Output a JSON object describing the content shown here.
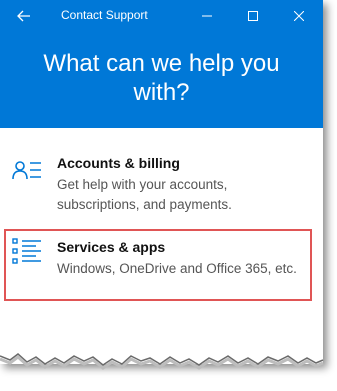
{
  "window": {
    "title": "Contact Support",
    "back_icon": "arrow-left-icon",
    "min_icon": "minimize-icon",
    "max_icon": "maximize-icon",
    "close_icon": "close-icon",
    "accent": "#0078d7"
  },
  "hero": {
    "heading": "What can we help you with?"
  },
  "options": [
    {
      "title": "Accounts & billing",
      "description": "Get help with your accounts, subscriptions, and payments.",
      "icon": "account-list-icon",
      "highlighted": false
    },
    {
      "title": "Services & apps",
      "description": "Windows, OneDrive and Office 365, etc.",
      "icon": "bulleted-list-icon",
      "highlighted": true,
      "highlight_color": "#e05555"
    }
  ]
}
